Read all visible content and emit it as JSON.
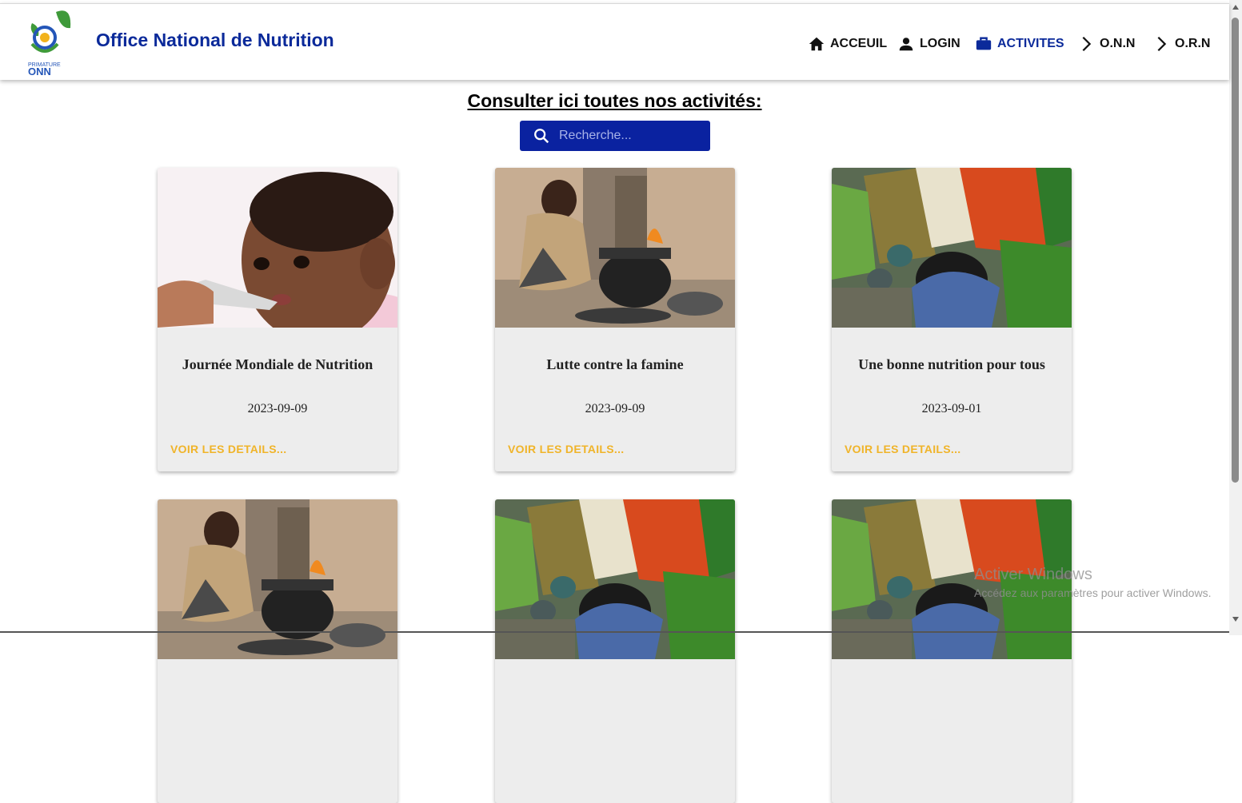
{
  "header": {
    "brand": "Office National de Nutrition",
    "logo_text": "ONN",
    "logo_caption": "PRIMATURE",
    "nav": [
      {
        "label": "ACCEUIL",
        "icon": "home-icon"
      },
      {
        "label": "LOGIN",
        "icon": "person-icon"
      },
      {
        "label": "ACTIVITES",
        "icon": "briefcase-icon",
        "active": true
      },
      {
        "label": "O.N.N",
        "icon": "chevron-right-icon"
      },
      {
        "label": "O.R.N",
        "icon": "chevron-right-icon"
      }
    ]
  },
  "main": {
    "heading": "Consulter ici toutes nos activités:",
    "search": {
      "placeholder": "Recherche..."
    },
    "cards": [
      {
        "title": "Journée Mondiale de Nutrition",
        "date": "2023-09-09",
        "action": "VOIR LES DETAILS...",
        "image": "baby-feeding"
      },
      {
        "title": "Lutte contre la famine",
        "date": "2023-09-09",
        "action": "VOIR LES DETAILS...",
        "image": "child-cooking"
      },
      {
        "title": "Une bonne nutrition pour tous",
        "date": "2023-09-01",
        "action": "VOIR LES DETAILS...",
        "image": "market-vegetables"
      },
      {
        "image": "child-cooking"
      },
      {
        "image": "market-vegetables"
      },
      {
        "image": "market-vegetables"
      }
    ]
  },
  "watermark": {
    "title": "Activer Windows",
    "subtitle": "Accédez aux paramètres pour activer Windows."
  },
  "colors": {
    "brand": "#0b2a9a",
    "search_bg": "#0a22a0",
    "accent": "#f0b429",
    "card_bg": "#ededed"
  }
}
